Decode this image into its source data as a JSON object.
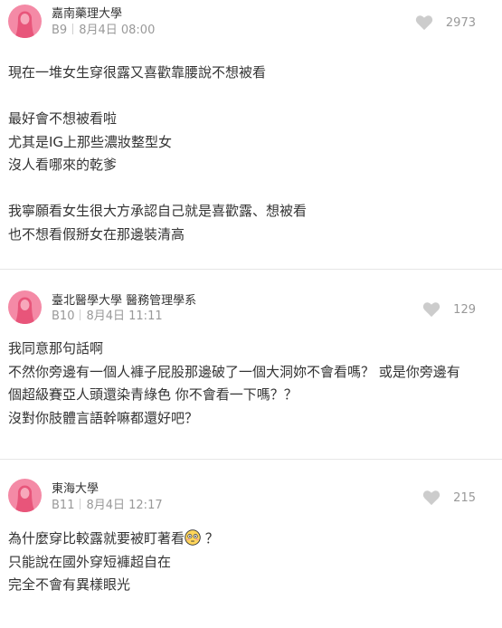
{
  "comments": [
    {
      "school": "嘉南藥理大學",
      "floor": "B9",
      "date": "8月4日 08:00",
      "likes": "2973",
      "lines": [
        "現在一堆女生穿很露又喜歡靠腰說不想被看",
        "",
        "最好會不想被看啦",
        "尤其是IG上那些濃妝整型女",
        "沒人看哪來的乾爹",
        "",
        "我寧願看女生很大方承認自己就是喜歡露、想被看",
        "也不想看假掰女在那邊裝清高"
      ]
    },
    {
      "school": "臺北醫學大學 醫務管理學系",
      "floor": "B10",
      "date": "8月4日 11:11",
      "likes": "129",
      "lines": [
        "我同意那句話啊",
        "不然你旁邊有一個人褲子屁股那邊破了一個大洞妳不會看嗎？ 或是你旁邊有",
        "個超級賽亞人頭還染青綠色 你不會看一下嗎？？",
        "沒對你肢體言語幹嘛都還好吧？"
      ]
    },
    {
      "school": "東海大學",
      "floor": "B11",
      "date": "8月4日 12:17",
      "likes": "215",
      "lines": [
        "為什麼穿比較露就要被盯著看",
        "只能說在國外穿短褲超自在",
        "完全不會有異樣眼光"
      ],
      "line0_suffix": " ？",
      "emoji_name": "flushed-face-emoji"
    }
  ],
  "colors": {
    "avatar": "#f48aa6",
    "meta": "#999999",
    "divider": "#e6e6e6",
    "heart": "#cccccc"
  }
}
